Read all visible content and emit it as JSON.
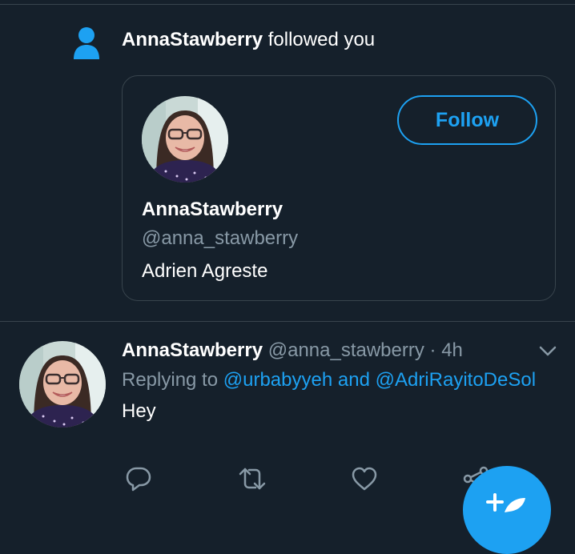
{
  "notification": {
    "user": "AnnaStawberry",
    "action_text": " followed you"
  },
  "profile_card": {
    "follow_label": "Follow",
    "name": "AnnaStawberry",
    "handle": "@anna_stawberry",
    "bio": "Adrien Agreste"
  },
  "tweet": {
    "name": "AnnaStawberry",
    "handle": "@anna_stawberry",
    "separator": " · ",
    "time": "4h",
    "replying_prefix": "Replying to ",
    "mention1": "@urbabyyeh",
    "conjunction": " and ",
    "mention2": "@AdriRayitoDeSol",
    "text": "Hey"
  },
  "icons": {
    "person": "person-icon",
    "reply": "reply-icon",
    "retweet": "retweet-icon",
    "like": "heart-icon",
    "share": "share-icon",
    "compose": "compose-tweet-icon",
    "chevron": "chevron-down-icon"
  },
  "colors": {
    "background": "#15202b",
    "accent": "#1da1f2",
    "secondary_text": "#8899a6",
    "border": "#38444d"
  }
}
